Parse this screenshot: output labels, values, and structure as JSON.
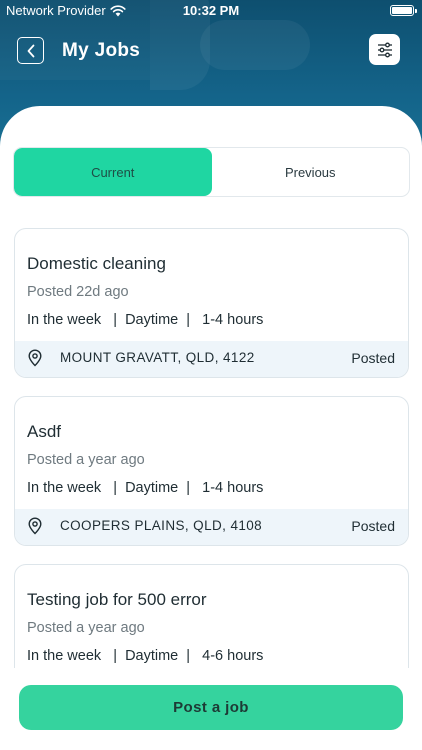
{
  "status_bar": {
    "carrier": "Network Provider",
    "time": "10:32 PM"
  },
  "header": {
    "title": "My Jobs"
  },
  "tabs": [
    {
      "label": "Current",
      "active": true
    },
    {
      "label": "Previous",
      "active": false
    }
  ],
  "jobs": [
    {
      "title": "Domestic cleaning",
      "posted": "Posted 22d ago",
      "details": "In the week   |  Daytime  |   1-4 hours",
      "location": "MOUNT GRAVATT, QLD, 4122",
      "status": "Posted"
    },
    {
      "title": "Asdf",
      "posted": "Posted a year ago",
      "details": "In the week   |  Daytime  |   1-4 hours",
      "location": "COOPERS PLAINS, QLD, 4108",
      "status": "Posted"
    },
    {
      "title": "Testing job for 500 error",
      "posted": "Posted a year ago",
      "details": "In the week   |  Daytime  |   4-6 hours",
      "location": "",
      "status": ""
    }
  ],
  "actions": {
    "post_job": "Post a job"
  },
  "colors": {
    "header": "#14648a",
    "accent": "#1fd6a2",
    "button": "#35d39e",
    "card_footer": "#eef5fa"
  },
  "icons": {
    "back": "chevron-left-icon",
    "filter": "sliders-icon",
    "location": "location-pin-icon",
    "wifi": "wifi-icon",
    "battery": "battery-icon"
  }
}
